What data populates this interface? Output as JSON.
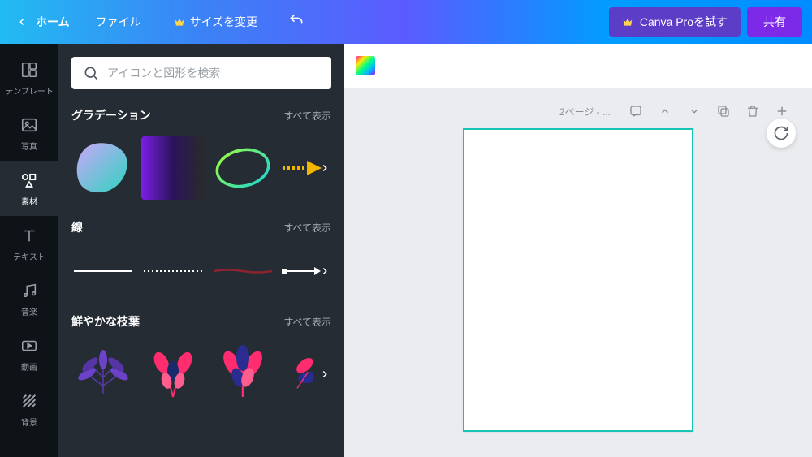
{
  "topbar": {
    "home": "ホーム",
    "file": "ファイル",
    "resize": "サイズを変更",
    "pro_button": "Canva Proを試す",
    "share_button": "共有"
  },
  "rail": {
    "templates": "テンプレート",
    "photos": "写真",
    "elements": "素材",
    "text": "テキスト",
    "music": "音楽",
    "video": "動画",
    "background": "背景"
  },
  "search": {
    "placeholder": "アイコンと図形を検索"
  },
  "sections": {
    "gradients": {
      "title": "グラデーション",
      "all": "すべて表示"
    },
    "lines": {
      "title": "線",
      "all": "すべて表示"
    },
    "foliage": {
      "title": "鮮やかな枝葉",
      "all": "すべて表示"
    }
  },
  "canvas": {
    "page_label": "2ページ - ..."
  }
}
